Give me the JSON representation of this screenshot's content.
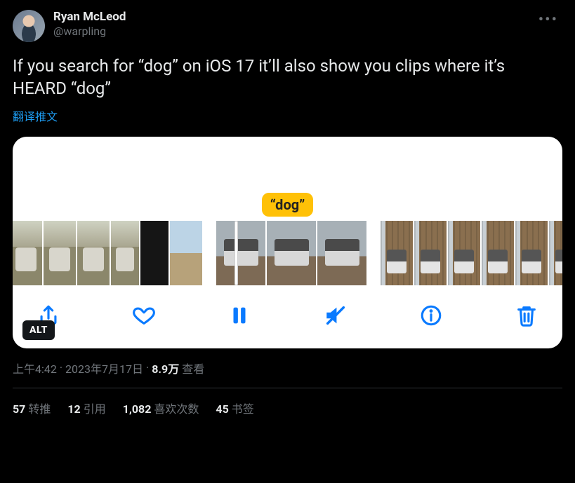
{
  "author": {
    "display_name": "Ryan McLeod",
    "handle": "@warpling"
  },
  "more_glyph": "•••",
  "body_text": "If you search for “dog” on iOS 17 it’ll also show you clips where it’s HEARD “dog”",
  "translate_label": "翻译推文",
  "media": {
    "search_bubble": "“dog”",
    "alt_badge": "ALT",
    "icons": {
      "share": "share-icon",
      "like": "heart-icon",
      "pause": "pause-icon",
      "mute": "muted-speaker-icon",
      "info": "info-icon",
      "trash": "trash-icon"
    }
  },
  "timestamp": {
    "time": "上午4:42",
    "sep1": " · ",
    "date": "2023年7月17日",
    "sep2": " · ",
    "views_value": "8.9万",
    "views_label": " 查看"
  },
  "stats": {
    "retweets": {
      "value": "57",
      "label": "转推"
    },
    "quotes": {
      "value": "12",
      "label": "引用"
    },
    "likes": {
      "value": "1,082",
      "label": "喜欢次数"
    },
    "bookmarks": {
      "value": "45",
      "label": "书签"
    }
  }
}
